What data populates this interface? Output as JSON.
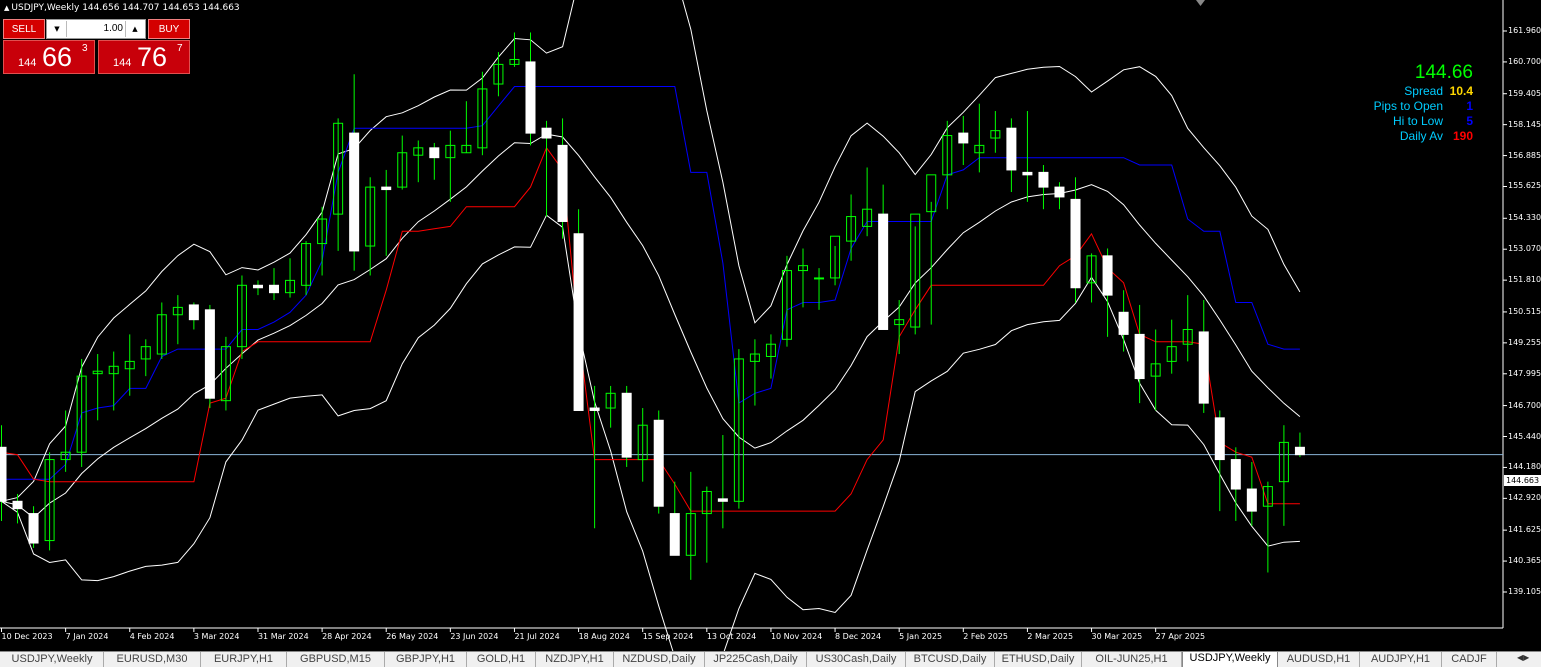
{
  "header": {
    "title": "USDJPY,Weekly  144.656 144.707 144.653 144.663"
  },
  "trade_panel": {
    "sell_label": "SELL",
    "buy_label": "BUY",
    "lot_size": "1.00",
    "sell_price": {
      "prefix": "144",
      "big": "66",
      "sup": "3"
    },
    "buy_price": {
      "prefix": "144",
      "big": "76",
      "sup": "7"
    }
  },
  "info": {
    "price": "144.66",
    "rows": [
      {
        "label": "Spread",
        "value": "10.4",
        "color": "#ffd700"
      },
      {
        "label": "Pips to Open",
        "value": "1",
        "color": "#0000ff"
      },
      {
        "label": "Hi to Low",
        "value": "5",
        "color": "#0000ff"
      },
      {
        "label": "Daily Av",
        "value": "190",
        "color": "#ff0000"
      }
    ]
  },
  "current_price_tag": "144.663",
  "colors": {
    "bull": "#ffffff",
    "wick": "#00ff00",
    "band": "#ffffff",
    "blue_line": "#0000ff",
    "red_line": "#ff0000",
    "price_line": "#8ab4d8"
  },
  "chart_data": {
    "type": "candlestick",
    "symbol": "USDJPY",
    "timeframe": "Weekly",
    "ylim": [
      138.8,
      162.9
    ],
    "y_ticks": [
      "161.960",
      "160.700",
      "159.405",
      "158.145",
      "156.885",
      "155.625",
      "154.330",
      "153.070",
      "151.810",
      "150.515",
      "149.255",
      "147.995",
      "146.700",
      "145.440",
      "144.180",
      "142.920",
      "141.625",
      "140.365",
      "139.105"
    ],
    "x_labels": [
      "10 Dec 2023",
      "7 Jan 2024",
      "4 Feb 2024",
      "3 Mar 2024",
      "31 Mar 2024",
      "28 Apr 2024",
      "26 May 2024",
      "23 Jun 2024",
      "21 Jul 2024",
      "18 Aug 2024",
      "15 Sep 2024",
      "13 Oct 2024",
      "10 Nov 2024",
      "8 Dec 2024",
      "5 Jan 2025",
      "2 Feb 2025",
      "2 Mar 2025",
      "30 Mar 2025",
      "27 Apr 2025"
    ],
    "candles": [
      [
        145.0,
        145.9,
        142.0,
        142.8
      ],
      [
        142.8,
        143.1,
        141.9,
        142.5
      ],
      [
        142.3,
        142.6,
        140.9,
        141.1
      ],
      [
        141.2,
        144.8,
        140.8,
        144.5
      ],
      [
        144.5,
        146.5,
        144.0,
        144.8
      ],
      [
        144.8,
        148.6,
        144.2,
        147.9
      ],
      [
        148.0,
        148.8,
        146.1,
        148.1
      ],
      [
        148.0,
        148.9,
        146.5,
        148.3
      ],
      [
        148.2,
        149.6,
        147.1,
        148.5
      ],
      [
        148.6,
        149.4,
        147.9,
        149.1
      ],
      [
        148.8,
        150.9,
        148.6,
        150.4
      ],
      [
        150.4,
        151.2,
        149.2,
        150.7
      ],
      [
        150.8,
        150.9,
        149.8,
        150.2
      ],
      [
        150.6,
        150.8,
        146.6,
        147.0
      ],
      [
        146.9,
        149.5,
        146.5,
        149.1
      ],
      [
        149.1,
        152.0,
        148.6,
        151.6
      ],
      [
        151.6,
        151.8,
        151.2,
        151.5
      ],
      [
        151.6,
        152.3,
        151.0,
        151.3
      ],
      [
        151.3,
        152.7,
        151.1,
        151.8
      ],
      [
        151.6,
        153.4,
        151.2,
        153.3
      ],
      [
        153.3,
        154.8,
        152.0,
        154.3
      ],
      [
        154.5,
        158.4,
        153.0,
        158.2
      ],
      [
        157.8,
        160.2,
        152.2,
        153.0
      ],
      [
        153.2,
        156.0,
        152.0,
        155.6
      ],
      [
        155.6,
        156.3,
        152.8,
        155.5
      ],
      [
        155.6,
        157.7,
        155.5,
        157.0
      ],
      [
        156.9,
        157.5,
        155.8,
        157.2
      ],
      [
        157.2,
        157.4,
        155.9,
        156.8
      ],
      [
        156.8,
        157.9,
        155.0,
        157.3
      ],
      [
        157.0,
        159.1,
        157.0,
        157.3
      ],
      [
        157.2,
        160.3,
        156.9,
        159.6
      ],
      [
        159.8,
        161.1,
        159.3,
        160.6
      ],
      [
        160.6,
        161.9,
        160.5,
        160.8
      ],
      [
        160.7,
        161.9,
        157.3,
        157.8
      ],
      [
        158.0,
        158.3,
        154.4,
        157.6
      ],
      [
        157.3,
        158.4,
        153.5,
        154.2
      ],
      [
        153.7,
        154.7,
        146.8,
        146.5
      ],
      [
        146.6,
        147.5,
        141.7,
        146.5
      ],
      [
        146.6,
        147.5,
        145.8,
        147.2
      ],
      [
        147.2,
        147.5,
        144.2,
        144.6
      ],
      [
        144.5,
        146.6,
        143.6,
        145.9
      ],
      [
        146.1,
        146.5,
        142.3,
        142.6
      ],
      [
        142.3,
        143.6,
        140.7,
        140.6
      ],
      [
        140.6,
        144.0,
        139.6,
        142.3
      ],
      [
        142.3,
        143.4,
        140.3,
        143.2
      ],
      [
        142.9,
        145.5,
        141.7,
        142.8
      ],
      [
        142.8,
        149.0,
        142.5,
        148.6
      ],
      [
        148.5,
        149.4,
        146.7,
        148.8
      ],
      [
        148.7,
        149.6,
        147.8,
        149.2
      ],
      [
        149.4,
        152.8,
        149.1,
        152.2
      ],
      [
        152.2,
        153.1,
        150.7,
        152.4
      ],
      [
        151.9,
        152.3,
        150.6,
        151.9
      ],
      [
        151.9,
        153.2,
        151.6,
        153.6
      ],
      [
        153.4,
        155.3,
        152.6,
        154.4
      ],
      [
        154.0,
        156.4,
        153.6,
        154.7
      ],
      [
        154.5,
        155.7,
        150.1,
        149.8
      ],
      [
        150.0,
        151.0,
        148.8,
        150.2
      ],
      [
        149.9,
        154.0,
        149.6,
        154.5
      ],
      [
        154.6,
        155.0,
        150.0,
        156.1
      ],
      [
        156.1,
        158.3,
        154.7,
        157.7
      ],
      [
        157.8,
        158.5,
        156.5,
        157.4
      ],
      [
        157.0,
        159.0,
        156.2,
        157.3
      ],
      [
        157.6,
        158.7,
        157.0,
        157.9
      ],
      [
        158.0,
        158.4,
        155.4,
        156.3
      ],
      [
        156.2,
        158.7,
        155.0,
        156.1
      ],
      [
        156.2,
        156.5,
        154.7,
        155.6
      ],
      [
        155.6,
        155.8,
        154.7,
        155.2
      ],
      [
        155.1,
        156.0,
        150.9,
        151.5
      ],
      [
        151.7,
        152.9,
        150.9,
        152.8
      ],
      [
        152.8,
        153.1,
        149.5,
        151.2
      ],
      [
        150.5,
        151.4,
        148.9,
        149.6
      ],
      [
        149.6,
        150.8,
        146.8,
        147.8
      ],
      [
        147.9,
        149.8,
        146.5,
        148.4
      ],
      [
        148.5,
        150.2,
        148.0,
        149.1
      ],
      [
        149.2,
        151.2,
        148.5,
        149.8
      ],
      [
        149.7,
        151.0,
        146.4,
        146.8
      ],
      [
        146.2,
        146.5,
        142.4,
        144.5
      ],
      [
        144.5,
        145.0,
        142.0,
        143.3
      ],
      [
        143.3,
        144.4,
        141.8,
        142.4
      ],
      [
        142.6,
        143.6,
        139.9,
        143.4
      ],
      [
        143.6,
        145.9,
        141.8,
        145.2
      ],
      [
        145.0,
        145.6,
        144.6,
        144.7
      ]
    ]
  },
  "tabs": [
    {
      "label": "USDJPY,Weekly"
    },
    {
      "label": "EURUSD,M30"
    },
    {
      "label": "EURJPY,H1"
    },
    {
      "label": "GBPUSD,M15"
    },
    {
      "label": "GBPJPY,H1"
    },
    {
      "label": "GOLD,H1"
    },
    {
      "label": "NZDJPY,H1"
    },
    {
      "label": "NZDUSD,Daily"
    },
    {
      "label": "JP225Cash,Daily"
    },
    {
      "label": "US30Cash,Daily"
    },
    {
      "label": "BTCUSD,Daily"
    },
    {
      "label": "ETHUSD,Daily"
    },
    {
      "label": "OIL-JUN25,H1"
    },
    {
      "label": "USDJPY,Weekly",
      "active": true
    },
    {
      "label": "AUDUSD,H1"
    },
    {
      "label": "AUDJPY,H1"
    },
    {
      "label": "CADJF"
    }
  ]
}
